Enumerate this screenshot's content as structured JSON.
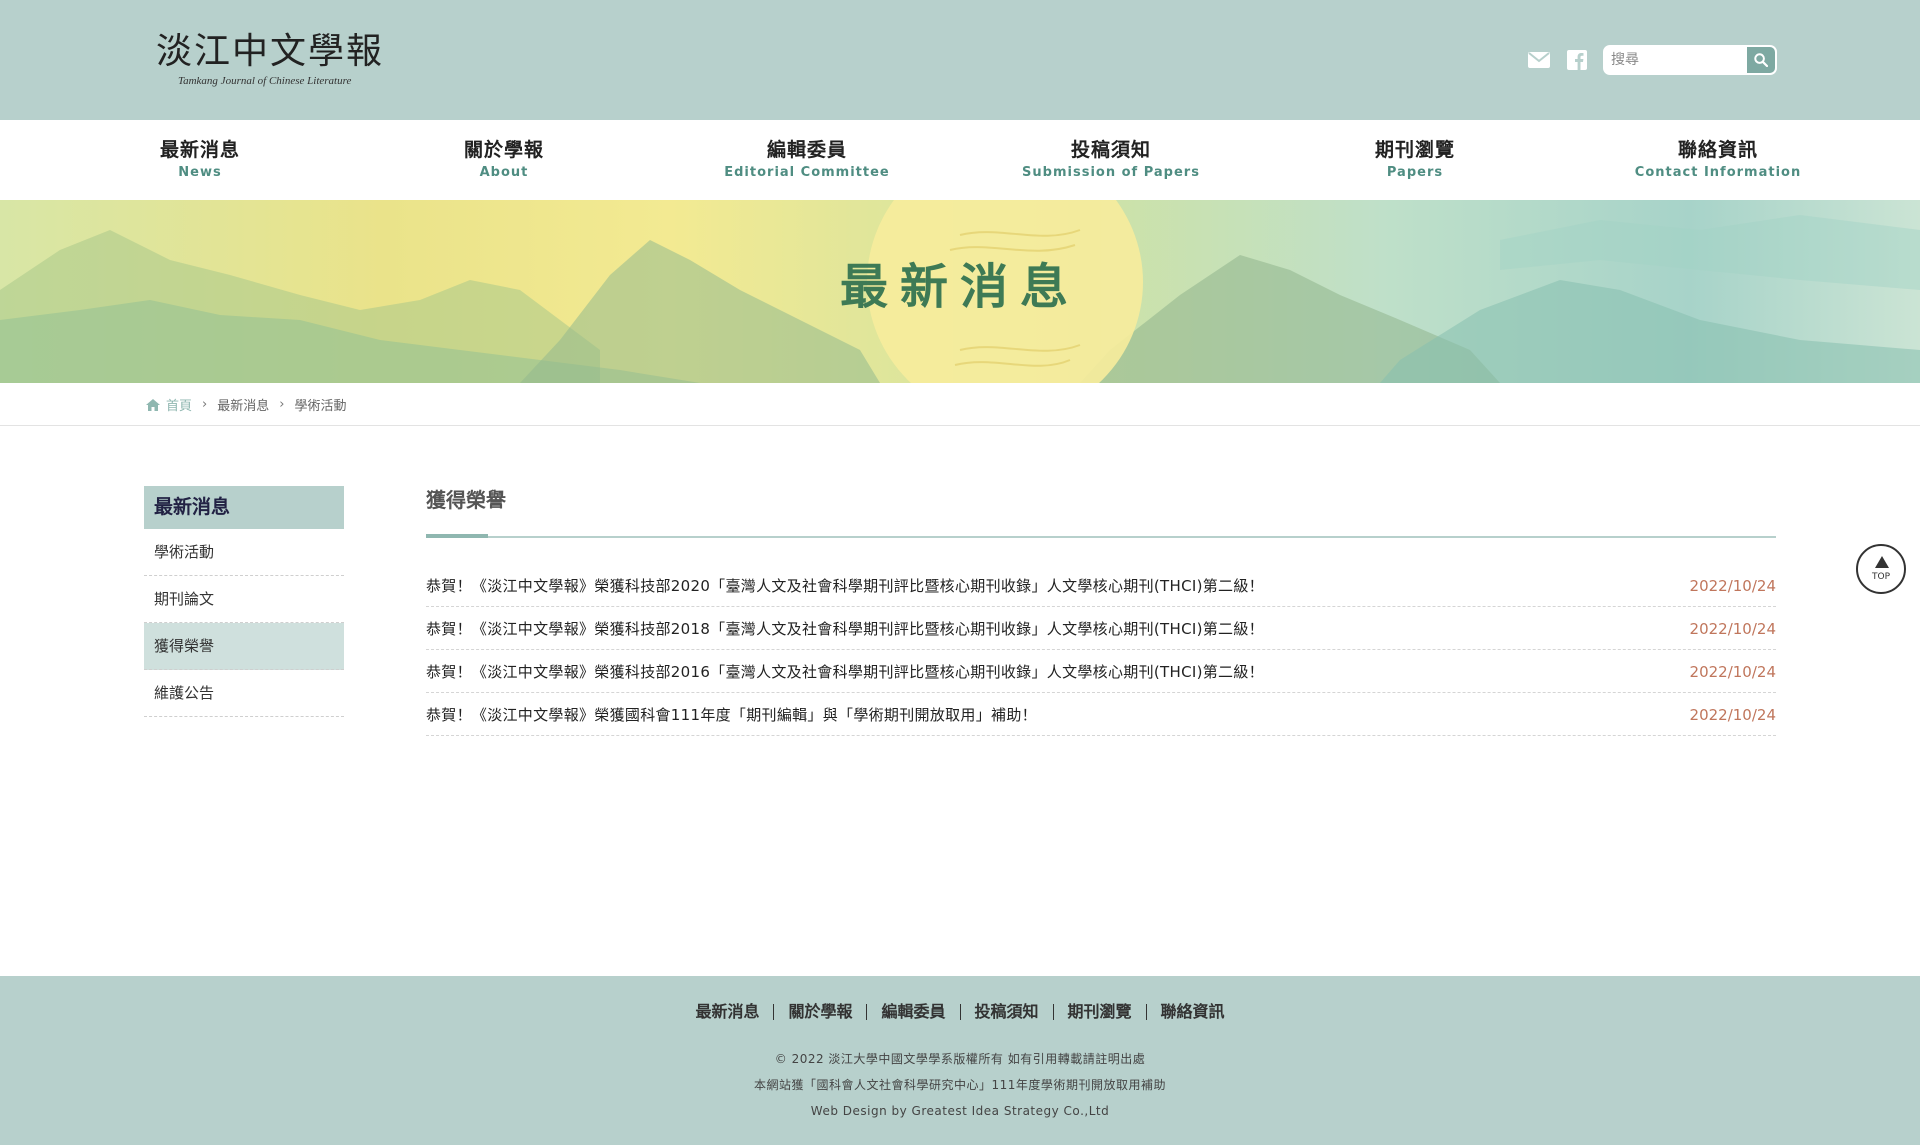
{
  "site": {
    "logo_text": "淡江中文學報",
    "logo_subtitle": "Tamkang Journal of Chinese Literature",
    "search_placeholder": "搜尋"
  },
  "nav": [
    {
      "zh": "最新消息",
      "en": "News"
    },
    {
      "zh": "關於學報",
      "en": "About"
    },
    {
      "zh": "編輯委員",
      "en": "Editorial Committee"
    },
    {
      "zh": "投稿須知",
      "en": "Submission of Papers"
    },
    {
      "zh": "期刊瀏覽",
      "en": "Papers"
    },
    {
      "zh": "聯絡資訊",
      "en": "Contact Information"
    }
  ],
  "banner": {
    "title": "最新消息"
  },
  "breadcrumb": [
    "首頁",
    "最新消息",
    "學術活動"
  ],
  "sidebar": {
    "heading": "最新消息",
    "items": [
      "學術活動",
      "期刊論文",
      "獲得榮譽",
      "維護公告"
    ],
    "active_index": 2
  },
  "main": {
    "title": "獲得榮譽",
    "items": [
      {
        "title": "恭賀！《淡江中文學報》榮獲科技部2020「臺灣人文及社會科學期刊評比暨核心期刊收錄」人文學核心期刊(THCI)第二級！",
        "date": "2022/10/24"
      },
      {
        "title": "恭賀！《淡江中文學報》榮獲科技部2018「臺灣人文及社會科學期刊評比暨核心期刊收錄」人文學核心期刊(THCI)第二級！",
        "date": "2022/10/24"
      },
      {
        "title": "恭賀！《淡江中文學報》榮獲科技部2016「臺灣人文及社會科學期刊評比暨核心期刊收錄」人文學核心期刊(THCI)第二級！",
        "date": "2022/10/24"
      },
      {
        "title": "恭賀！《淡江中文學報》榮獲國科會111年度「期刊編輯」與「學術期刊開放取用」補助！",
        "date": "2022/10/24"
      }
    ]
  },
  "top_button": {
    "label": "TOP"
  },
  "footer": {
    "links": [
      "最新消息",
      "關於學報",
      "編輯委員",
      "投稿須知",
      "期刊瀏覽",
      "聯絡資訊"
    ],
    "copyright": "© 2022 淡江大學中國文學學系版權所有 如有引用轉載請註明出處",
    "grant": "本網站獲「國科會人文社會科學研究中心」111年度學術期刊開放取用補助",
    "credit": "Web Design by Greatest Idea Strategy Co.,Ltd"
  },
  "colors": {
    "header_bg": "#b7d0cc",
    "accent_green": "#4f8d82",
    "date_color": "#c0765c",
    "banner_title": "#3e7a55"
  },
  "icons": [
    "mail-icon",
    "facebook-icon",
    "search-icon",
    "home-icon",
    "chevron-right-icon",
    "arrow-up-icon"
  ]
}
